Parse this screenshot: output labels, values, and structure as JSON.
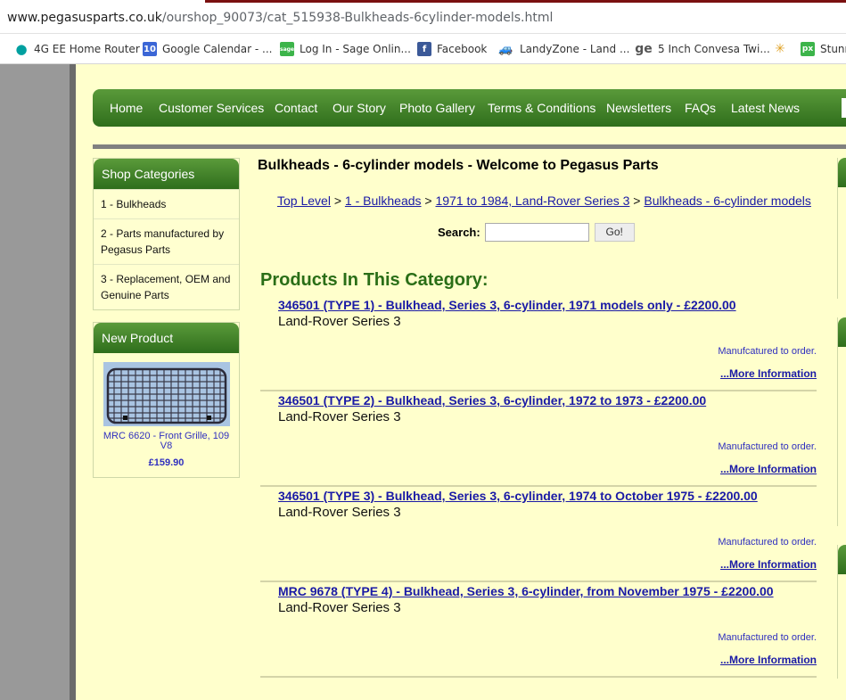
{
  "browser": {
    "url_domain": "www.pegasusparts.co.uk",
    "url_path": "/ourshop_90073/cat_515938-Bulkheads-6cylinder-models.html",
    "bookmarks": [
      {
        "label": "4G EE Home Router",
        "icon": "ee-icon"
      },
      {
        "label": "Google Calendar - ...",
        "icon": "calendar-icon"
      },
      {
        "label": "Log In - Sage Onlin...",
        "icon": "sage-icon"
      },
      {
        "label": "Facebook",
        "icon": "facebook-icon"
      },
      {
        "label": "LandyZone - Land ...",
        "icon": "car-icon"
      },
      {
        "label": "5 Inch Convesa Twi...",
        "icon": "ge-icon"
      },
      {
        "label": "",
        "icon": "pinwheel-icon"
      },
      {
        "label": "Stunn",
        "icon": "px-icon"
      }
    ]
  },
  "nav": [
    "Home",
    "Customer Services",
    "Contact",
    "Our Story",
    "Photo Gallery",
    "Terms & Conditions",
    "Newsletters",
    "FAQs",
    "Latest News"
  ],
  "sidebar": {
    "categories_title": "Shop Categories",
    "categories": [
      "1 - Bulkheads",
      "2 - Parts manufactured by Pegasus Parts",
      "3 - Replacement, OEM and Genuine Parts"
    ],
    "new_product_title": "New Product",
    "new_product_name": "MRC 6620 - Front Grille, 109 V8",
    "new_product_price": "£159.90"
  },
  "main": {
    "title": "Bulkheads - 6-cylinder models - Welcome to Pegasus Parts",
    "breadcrumb": [
      "Top Level",
      "1 - Bulkheads",
      "1971 to 1984, Land-Rover Series 3",
      "Bulkheads - 6-cylinder models"
    ],
    "breadcrumb_sep": " > ",
    "search_label": "Search:",
    "search_value": "",
    "go_label": "Go!",
    "products_heading": "Products In This Category:",
    "products": [
      {
        "title": "346501 (TYPE 1) - Bulkhead, Series 3, 6-cylinder, 1971 models only - £2200.00",
        "sub": "Land-Rover Series 3",
        "note": "Manufcatured to order.",
        "more": "...More Information"
      },
      {
        "title": "346501 (TYPE 2) - Bulkhead, Series 3, 6-cylinder, 1972 to 1973 - £2200.00",
        "sub": "Land-Rover Series 3",
        "note": "Manufactured to order.",
        "more": "...More Information"
      },
      {
        "title": "346501 (TYPE 3) - Bulkhead, Series 3, 6-cylinder, 1974 to October 1975 - £2200.00",
        "sub": "Land-Rover Series 3",
        "note": "Manufactured to order.",
        "more": "...More Information"
      },
      {
        "title": "MRC 9678 (TYPE 4) - Bulkhead, Series 3, 6-cylinder, from November 1975 - £2200.00",
        "sub": "Land-Rover Series 3",
        "note": "Manufactured to order.",
        "more": "...More Information"
      }
    ]
  }
}
